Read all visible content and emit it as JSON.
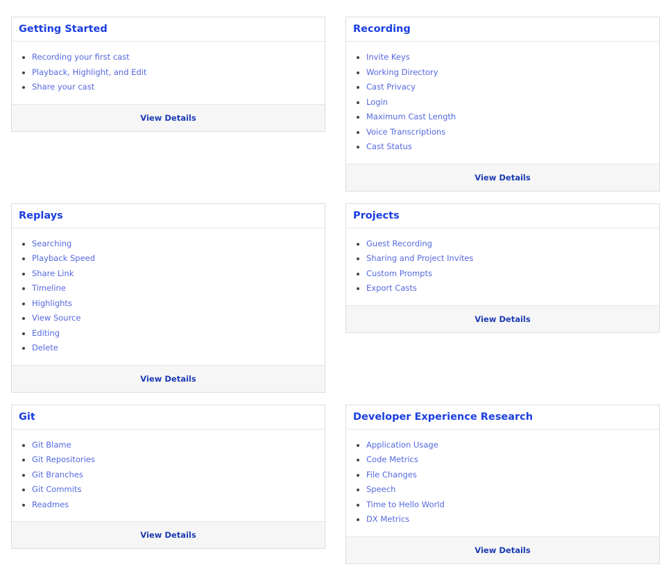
{
  "cards": [
    {
      "title": "Getting Started",
      "items": [
        "Recording your first cast",
        "Playback, Highlight, and Edit",
        "Share your cast"
      ],
      "footer": "View Details"
    },
    {
      "title": "Recording",
      "items": [
        "Invite Keys",
        "Working Directory",
        "Cast Privacy",
        "Login",
        "Maximum Cast Length",
        "Voice Transcriptions",
        "Cast Status"
      ],
      "footer": "View Details"
    },
    {
      "title": "Replays",
      "items": [
        "Searching",
        "Playback Speed",
        "Share Link",
        "Timeline",
        "Highlights",
        "View Source",
        "Editing",
        "Delete"
      ],
      "footer": "View Details"
    },
    {
      "title": "Projects",
      "items": [
        "Guest Recording",
        "Sharing and Project Invites",
        "Custom Prompts",
        "Export Casts"
      ],
      "footer": "View Details"
    },
    {
      "title": "Git",
      "items": [
        "Git Blame",
        "Git Repositories",
        "Git Branches",
        "Git Commits",
        "Readmes"
      ],
      "footer": "View Details"
    },
    {
      "title": "Developer Experience Research",
      "items": [
        "Application Usage",
        "Code Metrics",
        "File Changes",
        "Speech",
        "Time to Hello World",
        "DX Metrics"
      ],
      "footer": "View Details"
    }
  ]
}
